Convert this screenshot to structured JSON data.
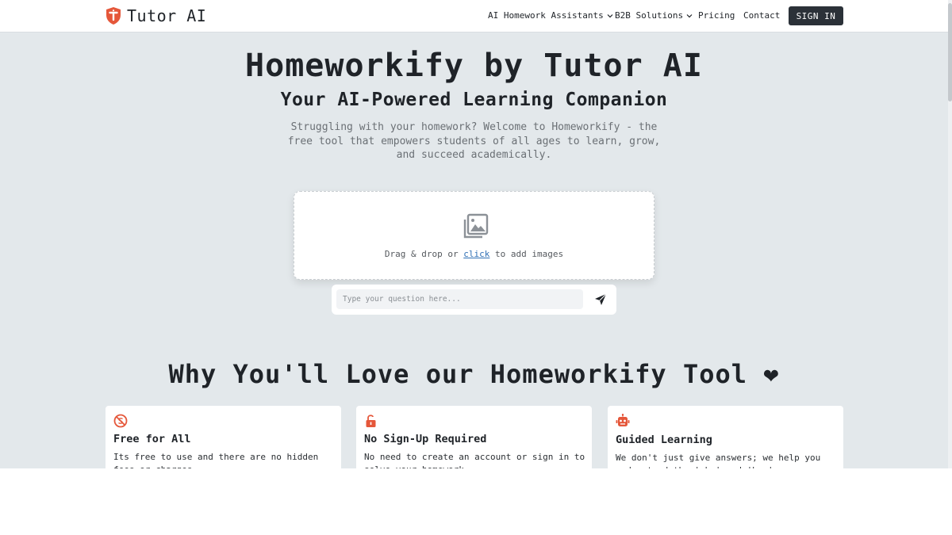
{
  "header": {
    "logo_text": "Tutor AI",
    "nav": [
      {
        "label": "AI Homework Assistants",
        "dropdown": true
      },
      {
        "label": "B2B Solutions",
        "dropdown": true
      },
      {
        "label": "Pricing",
        "dropdown": false
      },
      {
        "label": "Contact",
        "dropdown": false
      }
    ],
    "signin_label": "SIGN IN"
  },
  "hero": {
    "title": "Homeworkify by Tutor AI",
    "subtitle": "Your AI-Powered Learning Companion",
    "description": "Struggling with your homework? Welcome to Homeworkify - the free tool that empowers students of all ages to learn, grow, and succeed academically."
  },
  "upload": {
    "text_before": "Drag & drop or ",
    "link_text": "click",
    "text_after": " to add images",
    "icon": "images-icon"
  },
  "question": {
    "placeholder": "Type your question here...",
    "send_icon": "send-icon"
  },
  "features": {
    "title": "Why You'll Love our Homeworkify Tool",
    "heart": "❤",
    "cards": [
      {
        "icon": "no-fee-icon",
        "title": "Free for All",
        "text": "Its free to use and there are no hidden fees or charges."
      },
      {
        "icon": "unlock-icon",
        "title": "No Sign-Up Required",
        "text": "No need to create an account or sign in to solve your homework."
      },
      {
        "icon": "robot-icon",
        "title": "Guided Learning",
        "text": "We don't just give answers; we help you understand the 'why' and 'how'."
      }
    ]
  },
  "colors": {
    "accent": "#e5573a",
    "page_bg": "#e3e8eb",
    "button_dark": "#2b3138",
    "link": "#2f6fb5"
  }
}
